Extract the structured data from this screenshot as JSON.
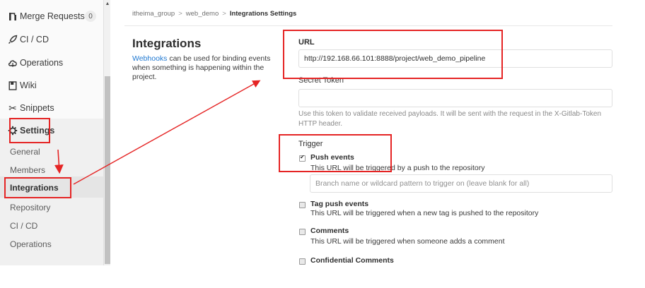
{
  "sidebar": {
    "merge_requests": {
      "label": "Merge Requests",
      "count": "0",
      "icon": "merge-request-icon"
    },
    "ci_cd": {
      "label": "CI / CD",
      "icon": "rocket-icon"
    },
    "operations": {
      "label": "Operations",
      "icon": "cloud-icon"
    },
    "wiki": {
      "label": "Wiki",
      "icon": "book-icon"
    },
    "snippets": {
      "label": "Snippets",
      "icon": "scissors-icon"
    },
    "settings": {
      "label": "Settings",
      "icon": "gear-icon"
    },
    "settings_items": [
      {
        "label": "General"
      },
      {
        "label": "Members"
      },
      {
        "label": "Integrations",
        "active": true
      },
      {
        "label": "Repository"
      },
      {
        "label": "CI / CD"
      },
      {
        "label": "Operations"
      }
    ]
  },
  "breadcrumb": {
    "group": "itheima_group",
    "project": "web_demo",
    "current": "Integrations Settings",
    "separator": ">"
  },
  "page": {
    "title": "Integrations",
    "desc_link": "Webhooks",
    "desc_rest": " can be used for binding events when something is happening within the project."
  },
  "form": {
    "url_label": "URL",
    "url_value": "http://192.168.66.101:8888/project/web_demo_pipeline",
    "secret_label": "Secret Token",
    "secret_value": "",
    "secret_help": "Use this token to validate received payloads. It will be sent with the request in the X-Gitlab-Token HTTP header.",
    "trigger_label": "Trigger",
    "push_events": {
      "title": "Push events",
      "desc": "This URL will be triggered by a push to the repository",
      "checked": true
    },
    "branch_placeholder": "Branch name or wildcard pattern to trigger on (leave blank for all)",
    "tag_push_events": {
      "title": "Tag push events",
      "desc": "This URL will be triggered when a new tag is pushed to the repository",
      "checked": false
    },
    "comments": {
      "title": "Comments",
      "desc": "This URL will be triggered when someone adds a comment",
      "checked": false
    },
    "confidential_comments": {
      "title": "Confidential Comments",
      "checked": false
    }
  },
  "colors": {
    "annotation": "#e52424",
    "link": "#1f78d1"
  }
}
